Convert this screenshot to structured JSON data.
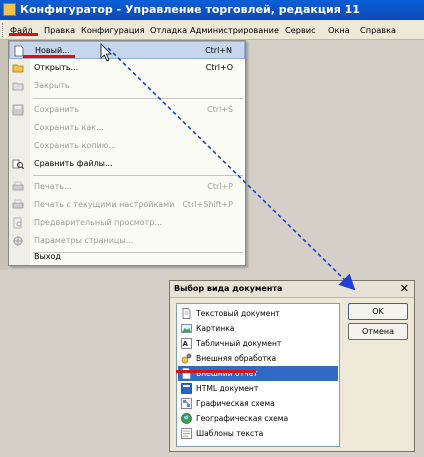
{
  "window": {
    "title": "Конфигуратор - Управление торговлей, редакция 11"
  },
  "menubar": {
    "items": [
      {
        "label": "Файл"
      },
      {
        "label": "Правка"
      },
      {
        "label": "Конфигурация"
      },
      {
        "label": "Отладка"
      },
      {
        "label": "Администрирование"
      },
      {
        "label": "Сервис"
      },
      {
        "label": "Окна"
      },
      {
        "label": "Справка"
      }
    ]
  },
  "file_menu": {
    "items": [
      {
        "label": "Новый...",
        "shortcut": "Ctrl+N",
        "enabled": true,
        "highlighted": true,
        "icon": "new-document-icon"
      },
      {
        "label": "Открыть...",
        "shortcut": "Ctrl+O",
        "enabled": true,
        "icon": "open-folder-icon"
      },
      {
        "label": "Закрыть",
        "shortcut": "",
        "enabled": false,
        "icon": "close-document-icon"
      },
      {
        "label": "Сохранить",
        "shortcut": "Ctrl+S",
        "enabled": false,
        "icon": "save-icon"
      },
      {
        "label": "Сохранить как...",
        "shortcut": "",
        "enabled": false,
        "icon": ""
      },
      {
        "label": "Сохранить копию...",
        "shortcut": "",
        "enabled": false,
        "icon": ""
      },
      {
        "label": "Сравнить файлы...",
        "shortcut": "",
        "enabled": true,
        "icon": "compare-files-icon"
      },
      {
        "label": "Печать...",
        "shortcut": "Ctrl+P",
        "enabled": false,
        "icon": "printer-icon"
      },
      {
        "label": "Печать с текущими настройками",
        "shortcut": "Ctrl+Shift+P",
        "enabled": false,
        "icon": "quick-print-icon"
      },
      {
        "label": "Предварительный просмотр...",
        "shortcut": "",
        "enabled": false,
        "icon": "print-preview-icon"
      },
      {
        "label": "Параметры страницы...",
        "shortcut": "",
        "enabled": false,
        "icon": "page-setup-icon"
      },
      {
        "label": "Выход",
        "shortcut": "",
        "enabled": true,
        "icon": ""
      }
    ]
  },
  "dialog": {
    "title": "Выбор вида документа",
    "close_label": "✕",
    "ok_label": "OK",
    "cancel_label": "Отмена",
    "items": [
      {
        "label": "Текстовый документ",
        "icon": "text-document-icon"
      },
      {
        "label": "Картинка",
        "icon": "picture-icon"
      },
      {
        "label": "Табличный документ",
        "icon": "spreadsheet-icon"
      },
      {
        "label": "Внешняя обработка",
        "icon": "external-processing-icon"
      },
      {
        "label": "Внешний отчет",
        "icon": "external-report-icon",
        "selected": true
      },
      {
        "label": "HTML документ",
        "icon": "html-document-icon"
      },
      {
        "label": "Графическая схема",
        "icon": "graphic-scheme-icon"
      },
      {
        "label": "Географическая схема",
        "icon": "geographic-scheme-icon"
      },
      {
        "label": "Шаблоны текста",
        "icon": "text-templates-icon"
      }
    ]
  },
  "colors": {
    "titlebar": "#0a5fd6",
    "highlight": "#c6d7ed",
    "selection": "#316ac5",
    "annotation_red": "#e01010",
    "annotation_arrow": "#1f3fdc"
  }
}
